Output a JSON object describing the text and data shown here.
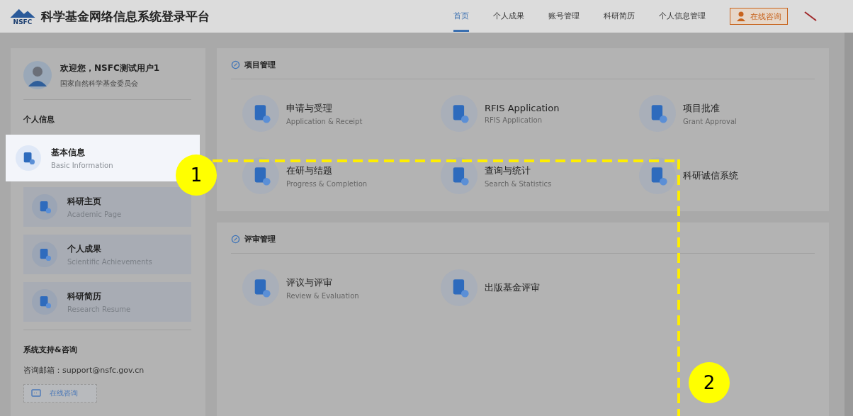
{
  "header": {
    "logo_text": "NSFC",
    "title": "科学基金网络信息系统登录平台",
    "nav": [
      {
        "label": "首页",
        "selected": true
      },
      {
        "label": "个人成果",
        "selected": false
      },
      {
        "label": "账号管理",
        "selected": false
      },
      {
        "label": "科研简历",
        "selected": false
      },
      {
        "label": "个人信息管理",
        "selected": false
      }
    ],
    "consult_button": "在线咨询"
  },
  "sidebar": {
    "greeting": "欢迎您，NSFC测试用户1",
    "organization": "国家自然科学基金委员会",
    "section_title": "个人信息",
    "items": [
      {
        "title": "基本信息",
        "subtitle": "Basic Information",
        "selected": true
      },
      {
        "title": "科研主页",
        "subtitle": "Academic Page",
        "selected": false
      },
      {
        "title": "个人成果",
        "subtitle": "Scientific Achievements",
        "selected": false
      },
      {
        "title": "科研简历",
        "subtitle": "Research Resume",
        "selected": false
      }
    ],
    "support_title": "系统支持&咨询",
    "support_email": "咨询邮箱：support@nsfc.gov.cn",
    "consult_button": "在线咨询"
  },
  "sections": [
    {
      "title": "项目管理",
      "items": [
        {
          "title": "申请与受理",
          "subtitle": "Application & Receipt"
        },
        {
          "title": "RFIS Application",
          "subtitle": "RFIS Application"
        },
        {
          "title": "项目批准",
          "subtitle": "Grant Approval"
        },
        {
          "title": "在研与结题",
          "subtitle": "Progress & Completion"
        },
        {
          "title": "查询与统计",
          "subtitle": "Search & Statistics"
        },
        {
          "title": "科研诚信系统"
        }
      ]
    },
    {
      "title": "评审管理",
      "items": [
        {
          "title": "评议与评审",
          "subtitle": "Review & Evaluation"
        },
        {
          "title": "出版基金评审"
        }
      ]
    }
  ],
  "callouts": [
    "1",
    "2"
  ]
}
